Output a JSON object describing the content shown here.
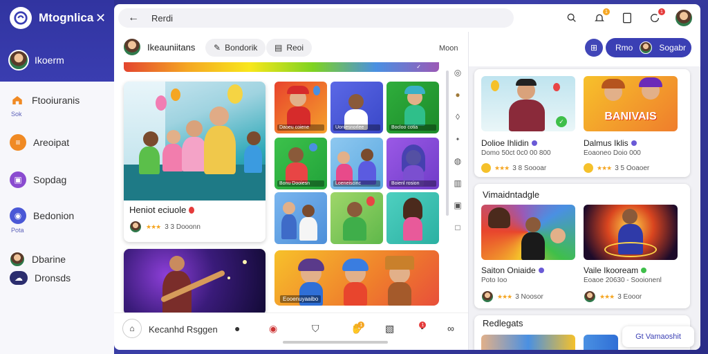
{
  "app": {
    "name": "Mtognlica"
  },
  "sidebar": {
    "profile_name": "Ikoerm",
    "items": [
      {
        "label": "Ftooiuranis",
        "sub": "Sok",
        "icon": "home-icon",
        "color": "#f08a24"
      },
      {
        "label": "Areoipat",
        "sub": "",
        "icon": "list-icon",
        "color": "#f08a24"
      },
      {
        "label": "Sopdag",
        "sub": "",
        "icon": "bag-icon",
        "color": "#8a4bd0"
      },
      {
        "label": "Bedonion",
        "sub": "Pota",
        "icon": "chat-icon",
        "color": "#4a58d6"
      },
      {
        "label": "Dbarine",
        "sub": "",
        "icon": "user-icon",
        "color": ""
      },
      {
        "label": "Dronsds",
        "sub": "",
        "icon": "cloud-icon",
        "color": ""
      }
    ]
  },
  "search": {
    "value": "Rerdi"
  },
  "notifications": {
    "bell_count": "1",
    "chat_count": "1"
  },
  "channel": {
    "name": "Ikeauniitans",
    "btn1": "Bondorik",
    "btn2": "Reoi",
    "more": "Moon"
  },
  "feature": {
    "title": "Heniot eciuole",
    "meta": "3  3  Dooonn"
  },
  "tiles": [
    "Daoeu coiene",
    "Uonlesnorlee",
    "Bocloo cotia",
    "Bonu Dooiesn",
    "Loeneiscinc",
    "Boienl rosion",
    "",
    "",
    ""
  ],
  "wide_tile_label": "Eooenuyaaibo",
  "bottom": {
    "text": "Kecanhd Rsggen",
    "badge1": "1",
    "badge2": "1"
  },
  "right": {
    "top_btn": "Rmo",
    "top_btn_user": "Sogabr",
    "cards": [
      {
        "title": "Dolioe Ihlidin",
        "sub": "Domo 50ct 0c0 00 800",
        "meta": "3  8  Soooar"
      },
      {
        "title": "Dalmus Iklis",
        "sub": "Eoaoneo Doio 000",
        "meta": "3  5  Ooaoer"
      }
    ],
    "section1": "Vimaidntadgle",
    "cards2": [
      {
        "title": "Saiton Oniaide",
        "sub": "Poto Ioo",
        "meta": "3  Noosor"
      },
      {
        "title": "Vaile Ikooream",
        "sub": "Eoaoe 20630 - Sooionenl",
        "meta": "3  Eooor"
      }
    ],
    "section2": "Redlegats",
    "fab": "Gt Vamaoshit",
    "banner_text": "BANIVAIS"
  },
  "colors": {
    "accent": "#3a3fb4",
    "sidebar_top": "#3134a0"
  }
}
